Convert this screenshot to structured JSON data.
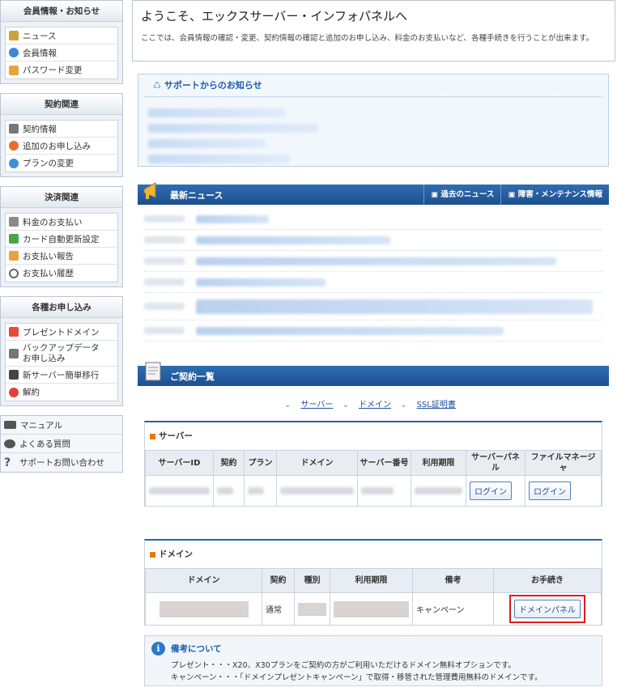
{
  "sidebar": {
    "account": {
      "title": "会員情報・お知らせ",
      "items": [
        {
          "label": "ニュース",
          "icon": "news-icon",
          "color": "#c9a23a"
        },
        {
          "label": "会員情報",
          "icon": "user-icon",
          "color": "#3a8ad6"
        },
        {
          "label": "パスワード変更",
          "icon": "lock-icon",
          "color": "#e8a43c"
        }
      ]
    },
    "contract": {
      "title": "契約関連",
      "items": [
        {
          "label": "契約情報",
          "icon": "contract-icon",
          "color": "#777777"
        },
        {
          "label": "追加のお申し込み",
          "icon": "add-icon",
          "color": "#e8702a"
        },
        {
          "label": "プランの変更",
          "icon": "refresh-icon",
          "color": "#3f8fd8"
        }
      ]
    },
    "payment": {
      "title": "決済関連",
      "items": [
        {
          "label": "料金のお支払い",
          "icon": "calculator-icon",
          "color": "#8a8a8a"
        },
        {
          "label": "カード自動更新設定",
          "icon": "card-icon",
          "color": "#4aa64a"
        },
        {
          "label": "お支払い報告",
          "icon": "report-icon",
          "color": "#e8a43c"
        },
        {
          "label": "お支払い履歴",
          "icon": "clock-icon",
          "color": "#666666"
        }
      ]
    },
    "apply": {
      "title": "各種お申し込み",
      "items": [
        {
          "label": "プレゼントドメイン",
          "icon": "gift-icon",
          "color": "#e24a3a"
        },
        {
          "label": "バックアップデータお申し込み",
          "icon": "backup-icon",
          "color": "#777777"
        },
        {
          "label": "新サーバー簡単移行",
          "icon": "server-icon",
          "color": "#444444"
        },
        {
          "label": "解約",
          "icon": "cancel-icon",
          "color": "#e0403a"
        }
      ]
    },
    "links": [
      {
        "label": "マニュアル",
        "icon": "book-icon"
      },
      {
        "label": "よくある質問",
        "icon": "chat-icon"
      },
      {
        "label": "サポートお問い合わせ",
        "icon": "question-icon"
      }
    ]
  },
  "welcome": {
    "title": "ようこそ、エックスサーバー・インフォパネルへ",
    "description": "ここでは、会員情報の確認・変更、契約情報の確認と追加のお申し込み、料金のお支払いなど、各種手続きを行うことが出来ます。"
  },
  "support": {
    "title": "サポートからのお知らせ"
  },
  "news": {
    "title": "最新ニュース",
    "past_news": "過去のニュース",
    "maintenance": "障害・メンテナンス情報"
  },
  "contracts": {
    "title": "ご契約一覧",
    "anchors": [
      "サーバー",
      "ドメイン",
      "SSL証明書"
    ]
  },
  "server_table": {
    "title": "サーバー",
    "headers": [
      "サーバーID",
      "契約",
      "プラン",
      "ドメイン",
      "サーバー番号",
      "利用期限",
      "サーバーパネル",
      "ファイルマネージャ"
    ],
    "login_label": "ログイン"
  },
  "domain_table": {
    "title": "ドメイン",
    "headers": [
      "ドメイン",
      "契約",
      "種別",
      "利用期限",
      "備考",
      "お手続き"
    ],
    "row": {
      "contract": "通常",
      "note": "キャンペーン",
      "action": "ドメインパネル"
    }
  },
  "note": {
    "title": "備考について",
    "lines": [
      "プレゼント・・・X20、X30プランをご契約の方がご利用いただけるドメイン無料オプションです。",
      "キャンペーン・・・「ドメインプレゼントキャンペーン」で取得・移管された管理費用無料のドメインです。"
    ]
  },
  "colors": {
    "accent": "#1d4f8e",
    "highlight": "#e01b1b",
    "marker": "#e47b10"
  }
}
